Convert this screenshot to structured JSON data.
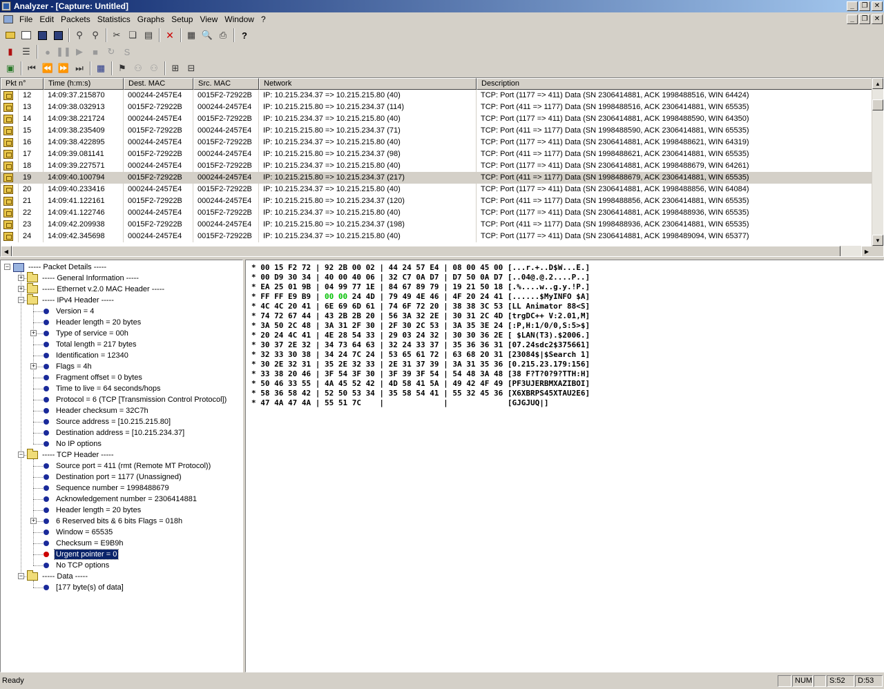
{
  "window": {
    "title": "Analyzer - [Capture: Untitled]"
  },
  "menu": [
    "File",
    "Edit",
    "Packets",
    "Statistics",
    "Graphs",
    "Setup",
    "View",
    "Window",
    "?"
  ],
  "packet_columns": [
    "Pkt n°",
    "Time (h:m:s)",
    "Dest. MAC",
    "Src. MAC",
    "Network",
    "Description"
  ],
  "packets": [
    {
      "no": "12",
      "time": "14:09:37.215870",
      "dst": "000244-2457E4",
      "src": "0015F2-72922B",
      "net": "IP:  10.215.234.37 => 10.215.215.80  (40)",
      "desc": "TCP:  Port (1177 => 411)  Data (SN 2306414881, ACK 1998488516, WIN 64424)"
    },
    {
      "no": "13",
      "time": "14:09:38.032913",
      "dst": "0015F2-72922B",
      "src": "000244-2457E4",
      "net": "IP:  10.215.215.80 => 10.215.234.37  (114)",
      "desc": "TCP:  Port (411 => 1177)  Data (SN 1998488516, ACK 2306414881, WIN 65535)"
    },
    {
      "no": "14",
      "time": "14:09:38.221724",
      "dst": "000244-2457E4",
      "src": "0015F2-72922B",
      "net": "IP:  10.215.234.37 => 10.215.215.80  (40)",
      "desc": "TCP:  Port (1177 => 411)  Data (SN 2306414881, ACK 1998488590, WIN 64350)"
    },
    {
      "no": "15",
      "time": "14:09:38.235409",
      "dst": "0015F2-72922B",
      "src": "000244-2457E4",
      "net": "IP:  10.215.215.80 => 10.215.234.37  (71)",
      "desc": "TCP:  Port (411 => 1177)  Data (SN 1998488590, ACK 2306414881, WIN 65535)"
    },
    {
      "no": "16",
      "time": "14:09:38.422895",
      "dst": "000244-2457E4",
      "src": "0015F2-72922B",
      "net": "IP:  10.215.234.37 => 10.215.215.80  (40)",
      "desc": "TCP:  Port (1177 => 411)  Data (SN 2306414881, ACK 1998488621, WIN 64319)"
    },
    {
      "no": "17",
      "time": "14:09:39.081141",
      "dst": "0015F2-72922B",
      "src": "000244-2457E4",
      "net": "IP:  10.215.215.80 => 10.215.234.37  (98)",
      "desc": "TCP:  Port (411 => 1177)  Data (SN 1998488621, ACK 2306414881, WIN 65535)"
    },
    {
      "no": "18",
      "time": "14:09:39.227571",
      "dst": "000244-2457E4",
      "src": "0015F2-72922B",
      "net": "IP:  10.215.234.37 => 10.215.215.80  (40)",
      "desc": "TCP:  Port (1177 => 411)  Data (SN 2306414881, ACK 1998488679, WIN 64261)"
    },
    {
      "no": "19",
      "time": "14:09:40.100794",
      "dst": "0015F2-72922B",
      "src": "000244-2457E4",
      "net": "IP:  10.215.215.80 => 10.215.234.37  (217)",
      "desc": "TCP:  Port (411 => 1177)  Data (SN 1998488679, ACK 2306414881, WIN 65535)",
      "selected": true
    },
    {
      "no": "20",
      "time": "14:09:40.233416",
      "dst": "000244-2457E4",
      "src": "0015F2-72922B",
      "net": "IP:  10.215.234.37 => 10.215.215.80  (40)",
      "desc": "TCP:  Port (1177 => 411)  Data (SN 2306414881, ACK 1998488856, WIN 64084)"
    },
    {
      "no": "21",
      "time": "14:09:41.122161",
      "dst": "0015F2-72922B",
      "src": "000244-2457E4",
      "net": "IP:  10.215.215.80 => 10.215.234.37  (120)",
      "desc": "TCP:  Port (411 => 1177)  Data (SN 1998488856, ACK 2306414881, WIN 65535)"
    },
    {
      "no": "22",
      "time": "14:09:41.122746",
      "dst": "000244-2457E4",
      "src": "0015F2-72922B",
      "net": "IP:  10.215.234.37 => 10.215.215.80  (40)",
      "desc": "TCP:  Port (1177 => 411)  Data (SN 2306414881, ACK 1998488936, WIN 65535)"
    },
    {
      "no": "23",
      "time": "14:09:42.209938",
      "dst": "0015F2-72922B",
      "src": "000244-2457E4",
      "net": "IP:  10.215.215.80 => 10.215.234.37  (198)",
      "desc": "TCP:  Port (411 => 1177)  Data (SN 1998488936, ACK 2306414881, WIN 65535)"
    },
    {
      "no": "24",
      "time": "14:09:42.345698",
      "dst": "000244-2457E4",
      "src": "0015F2-72922B",
      "net": "IP:  10.215.234.37 => 10.215.215.80  (40)",
      "desc": "TCP:  Port (1177 => 411)  Data (SN 2306414881, ACK 1998489094, WIN 65377)"
    }
  ],
  "tree": [
    {
      "label": "----- Packet Details -----",
      "type": "root",
      "expanded": true
    },
    {
      "label": "----- General Information -----",
      "type": "folder",
      "expanded": false
    },
    {
      "label": "----- Ethernet v.2.0 MAC Header -----",
      "type": "folder",
      "expanded": false
    },
    {
      "label": "----- IPv4 Header -----",
      "type": "folder",
      "expanded": true
    },
    {
      "label": "Version = 4",
      "type": "leaf"
    },
    {
      "label": "Header length = 20 bytes",
      "type": "leaf"
    },
    {
      "label": "Type of service = 00h",
      "type": "leaf",
      "has_children": true
    },
    {
      "label": "Total length = 217 bytes",
      "type": "leaf"
    },
    {
      "label": "Identification = 12340",
      "type": "leaf"
    },
    {
      "label": "Flags = 4h",
      "type": "leaf",
      "has_children": true
    },
    {
      "label": "Fragment offset = 0 bytes",
      "type": "leaf"
    },
    {
      "label": "Time to live = 64 seconds/hops",
      "type": "leaf"
    },
    {
      "label": "Protocol = 6 (TCP [Transmission Control Protocol])",
      "type": "leaf"
    },
    {
      "label": "Header checksum = 32C7h",
      "type": "leaf"
    },
    {
      "label": "Source address = [10.215.215.80]",
      "type": "leaf"
    },
    {
      "label": "Destination address = [10.215.234.37]",
      "type": "leaf"
    },
    {
      "label": "No IP options",
      "type": "leaf"
    },
    {
      "label": "----- TCP Header -----",
      "type": "folder",
      "expanded": true
    },
    {
      "label": "Source port = 411 (rmt (Remote MT Protocol))",
      "type": "leaf"
    },
    {
      "label": "Destination port = 1177 (Unassigned)",
      "type": "leaf"
    },
    {
      "label": "Sequence number = 1998488679",
      "type": "leaf"
    },
    {
      "label": "Acknowledgement number = 2306414881",
      "type": "leaf"
    },
    {
      "label": "Header length = 20 bytes",
      "type": "leaf"
    },
    {
      "label": "6 Reserved bits & 6 bits Flags = 018h",
      "type": "leaf",
      "has_children": true
    },
    {
      "label": "Window = 65535",
      "type": "leaf"
    },
    {
      "label": "Checksum = E9B9h",
      "type": "leaf"
    },
    {
      "label": "Urgent pointer = 0",
      "type": "leaf",
      "selected": true
    },
    {
      "label": "No TCP options",
      "type": "leaf"
    },
    {
      "label": "----- Data -----",
      "type": "folder",
      "expanded": true
    },
    {
      "label": "[177 byte(s) of data]",
      "type": "leaf"
    }
  ],
  "hex_rows": [
    "* 00 15 F2 72 | 92 2B 00 02 | 44 24 57 E4 | 08 00 45 00 [...r.+..D$W...E.]",
    "* 00 D9 30 34 | 40 00 40 06 | 32 C7 0A D7 | D7 50 0A D7 [..04@.@.2....P..]",
    "* EA 25 01 9B | 04 99 77 1E | 84 67 89 79 | 19 21 50 18 [.%....w..g.y.!P.]",
    "* FF FF E9 B9 | 00 00 24 4D | 79 49 4E 46 | 4F 20 24 41 [......$MyINFO $A]",
    "* 4C 4C 20 41 | 6E 69 6D 61 | 74 6F 72 20 | 38 38 3C 53 [LL Animator 88<S]",
    "* 74 72 67 44 | 43 2B 2B 20 | 56 3A 32 2E | 30 31 2C 4D [trgDC++ V:2.01,M]",
    "* 3A 50 2C 48 | 3A 31 2F 30 | 2F 30 2C 53 | 3A 35 3E 24 [:P,H:1/0/0,S:5>$]",
    "* 20 24 4C 41 | 4E 28 54 33 | 29 03 24 32 | 30 30 36 2E [ $LAN(T3).$2006.]",
    "* 30 37 2E 32 | 34 73 64 63 | 32 24 33 37 | 35 36 36 31 [07.24sdc2$375661]",
    "* 32 33 30 38 | 34 24 7C 24 | 53 65 61 72 | 63 68 20 31 [23084$|$Search 1]",
    "* 30 2E 32 31 | 35 2E 32 33 | 2E 31 37 39 | 3A 31 35 36 [0.215.23.179:156]",
    "* 33 38 20 46 | 3F 54 3F 30 | 3F 39 3F 54 | 54 48 3A 48 [38 F?T?0?9?TTH:H]",
    "* 50 46 33 55 | 4A 45 52 42 | 4D 58 41 5A | 49 42 4F 49 [PF3UJERBMXAZIBOI]",
    "* 58 36 58 42 | 52 50 53 34 | 35 58 54 41 | 55 32 45 36 [X6XBRPS45XTAU2E6]",
    "* 47 4A 47 4A | 55 51 7C    |             |             [GJGJUQ|]"
  ],
  "hex_highlight": {
    "row": 3,
    "text": "00 00",
    "color": "#00c000"
  },
  "status": {
    "text": "Ready",
    "num": "NUM",
    "s": "S:52",
    "d": "D:53"
  }
}
